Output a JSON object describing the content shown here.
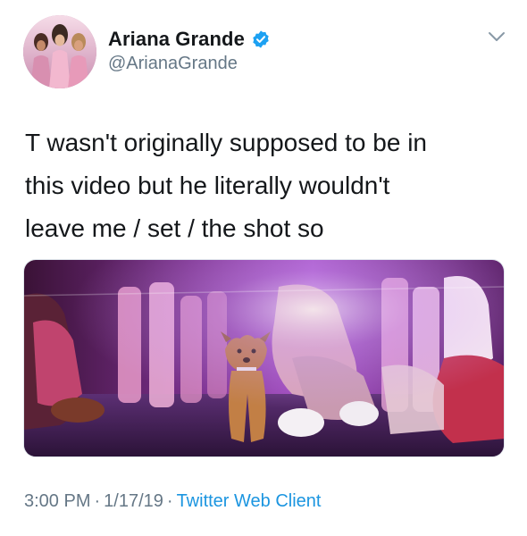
{
  "author": {
    "display_name": "Ariana Grande",
    "handle": "@ArianaGrande",
    "verified": true,
    "avatar_icon": "profile-photo"
  },
  "tweet": {
    "text": "T wasn't originally supposed to be in\nthis video but he literally wouldn't\nleave me / set / the shot so",
    "media": {
      "type": "photo",
      "icon": "dog-on-video-set-photo"
    }
  },
  "meta": {
    "time": "3:00 PM",
    "date": "1/17/19",
    "separator": "·",
    "source": "Twitter Web Client"
  },
  "colors": {
    "text": "#14171a",
    "secondary": "#657786",
    "link": "#1b95e0",
    "verified": "#1da1f2"
  },
  "icons": {
    "menu": "chevron-down-icon",
    "verified": "verified-badge-icon"
  }
}
